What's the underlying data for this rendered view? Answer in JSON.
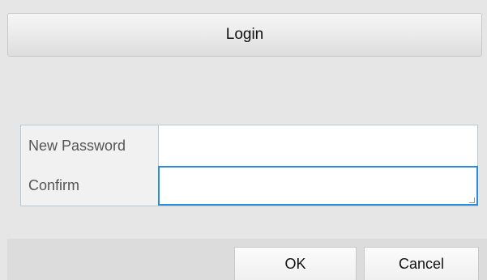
{
  "dialog": {
    "title": "Login"
  },
  "form": {
    "new_password": {
      "label": "New Password",
      "value": ""
    },
    "confirm": {
      "label": "Confirm",
      "value": ""
    }
  },
  "buttons": {
    "ok_label": "OK",
    "cancel_label": "Cancel"
  },
  "colors": {
    "focus_border": "#2a8cdc",
    "field_border": "#b9c8d8",
    "dialog_background": "#e6e6e6"
  }
}
